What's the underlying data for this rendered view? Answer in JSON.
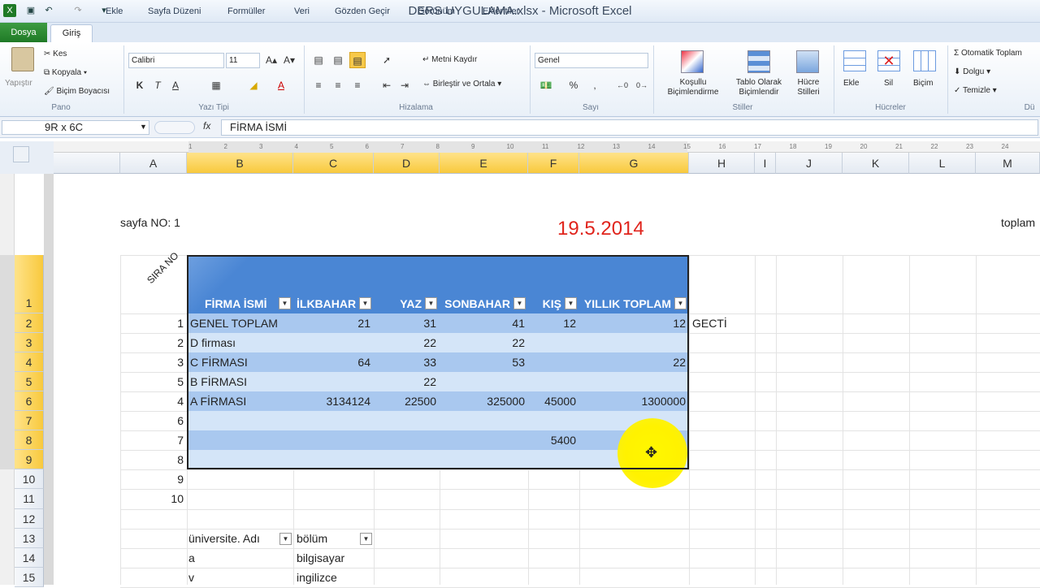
{
  "window": {
    "title": "DERS UYGULAMA.xlsx  -  Microsoft Excel"
  },
  "tabs": [
    "Dosya",
    "Giriş",
    "Ekle",
    "Sayfa Düzeni",
    "Formüller",
    "Veri",
    "Gözden Geçir",
    "Görünüm",
    "Eklentiler"
  ],
  "ribbon": {
    "clipboard": {
      "paste": "Yapıştır",
      "cut": "Kes",
      "copy": "Kopyala",
      "format_painter": "Biçim Boyacısı",
      "group": "Pano"
    },
    "font": {
      "name": "Calibri",
      "size": "11",
      "bold": "K",
      "italic": "T",
      "underline": "A",
      "group": "Yazı Tipi"
    },
    "alignment": {
      "wrap": "Metni Kaydır",
      "merge": "Birleştir ve Ortala",
      "group": "Hizalama"
    },
    "number": {
      "format": "Genel",
      "percent": "%",
      "comma": "000",
      "group": "Sayı"
    },
    "styles": {
      "conditional": "Koşullu\nBiçimlendirme",
      "table": "Tablo Olarak\nBiçimlendir",
      "cell": "Hücre\nStilleri",
      "group": "Stiller"
    },
    "cells": {
      "insert": "Ekle",
      "delete": "Sil",
      "format": "Biçim",
      "group": "Hücreler"
    },
    "editing": {
      "autosum": "Otomatik Toplam",
      "fill": "Dolgu",
      "clear": "Temizle",
      "group": "Dü"
    }
  },
  "formula_bar": {
    "name_box": "9R x 6C",
    "fx": "fx",
    "content": "FİRMA İSMİ"
  },
  "columns": [
    "A",
    "B",
    "C",
    "D",
    "E",
    "F",
    "G",
    "H",
    "I",
    "J",
    "K",
    "L",
    "M"
  ],
  "rows": [
    "1",
    "2",
    "3",
    "4",
    "5",
    "6",
    "7",
    "8",
    "9",
    "10",
    "11",
    "12",
    "13",
    "14",
    "15"
  ],
  "ruler_numbers": [
    "1",
    "2",
    "3",
    "4",
    "5",
    "6",
    "7",
    "8",
    "9",
    "10",
    "11",
    "12",
    "13",
    "14",
    "15",
    "16",
    "17",
    "18",
    "19",
    "20",
    "21",
    "22",
    "23",
    "24"
  ],
  "sheet": {
    "page_header_left": "sayfa NO: 1",
    "page_header_center": "19.5.2014",
    "page_header_right": "toplam",
    "sira_no_header": "SIRA NO",
    "table_headers": [
      "FİRMA İSMİ",
      "İLKBAHAR",
      "YAZ",
      "SONBAHAR",
      "KIŞ",
      "YILLIK TOPLAM"
    ],
    "table_rows": [
      {
        "sira": "1",
        "firma": "GENEL TOPLAM",
        "ilkbahar": "21",
        "yaz": "31",
        "sonbahar": "41",
        "kis": "12",
        "yillik": "12",
        "extra": "GECTİ"
      },
      {
        "sira": "2",
        "firma": "D firması",
        "ilkbahar": "",
        "yaz": "22",
        "sonbahar": "22",
        "kis": "",
        "yillik": "",
        "extra": ""
      },
      {
        "sira": "3",
        "firma": "C FİRMASI",
        "ilkbahar": "64",
        "yaz": "33",
        "sonbahar": "53",
        "kis": "",
        "yillik": "22",
        "extra": ""
      },
      {
        "sira": "5",
        "firma": "B FİRMASI",
        "ilkbahar": "",
        "yaz": "22",
        "sonbahar": "",
        "kis": "",
        "yillik": "",
        "extra": ""
      },
      {
        "sira": "4",
        "firma": "A FİRMASI",
        "ilkbahar": "3134124",
        "yaz": "22500",
        "sonbahar": "325000",
        "kis": "45000",
        "yillik": "1300000",
        "extra": ""
      },
      {
        "sira": "6",
        "firma": "",
        "ilkbahar": "",
        "yaz": "",
        "sonbahar": "",
        "kis": "",
        "yillik": "",
        "extra": ""
      },
      {
        "sira": "7",
        "firma": "",
        "ilkbahar": "",
        "yaz": "",
        "sonbahar": "",
        "kis": "5400",
        "yillik": "",
        "extra": ""
      },
      {
        "sira": "8",
        "firma": "",
        "ilkbahar": "",
        "yaz": "",
        "sonbahar": "",
        "kis": "",
        "yillik": "",
        "extra": ""
      }
    ],
    "after_rows": [
      {
        "sira": "9"
      },
      {
        "sira": "10"
      }
    ],
    "second_table": {
      "headers": [
        "üniversite. Adı",
        "bölüm"
      ],
      "rows": [
        [
          "a",
          "bilgisayar"
        ],
        [
          "v",
          "ingilizce"
        ]
      ]
    }
  },
  "colors": {
    "table_header": "#4a86d4",
    "band_dark": "#a9c8ef",
    "band_light": "#d4e5f8",
    "date_red": "#e0241c",
    "highlight": "#fff200"
  }
}
